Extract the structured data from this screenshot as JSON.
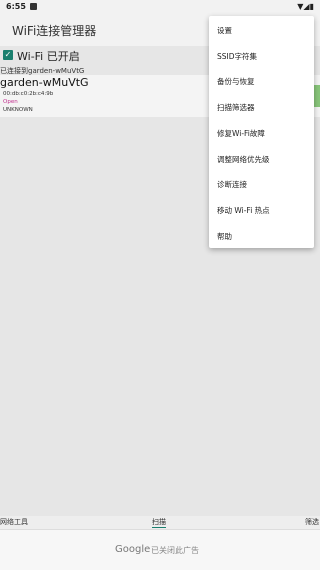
{
  "status_bar": {
    "time": "6:55",
    "icons": "▼◢▮"
  },
  "app": {
    "title": "WiFi连接管理器"
  },
  "wifi": {
    "toggle_label": "Wi-Fi 已开启",
    "connected_text": "已连接到garden-wMuVtG",
    "network": {
      "ssid": "garden-wMuVtG",
      "bssid": "00:db:c0:2b:c4:9b",
      "security": "Open",
      "status": "UNKNOWN"
    }
  },
  "menu": {
    "items": [
      {
        "label": "设置"
      },
      {
        "label": "SSID字符集"
      },
      {
        "label": "备份与恢复"
      },
      {
        "label": "扫描筛选器"
      },
      {
        "label": "修复Wi-Fi故障"
      },
      {
        "label": "调整网络优先级"
      },
      {
        "label": "诊断连接"
      },
      {
        "label": "移动 Wi-Fi 热点"
      },
      {
        "label": "帮助"
      }
    ]
  },
  "tabs": [
    {
      "label": "网络工具"
    },
    {
      "label": "扫描"
    },
    {
      "label": "筛选"
    }
  ],
  "ad": {
    "brand": "Google",
    "text": "已关闭此广告"
  },
  "colors": {
    "accent": "#1a7f6e",
    "security_open": "#c0308e",
    "signal": "#88c57a"
  }
}
